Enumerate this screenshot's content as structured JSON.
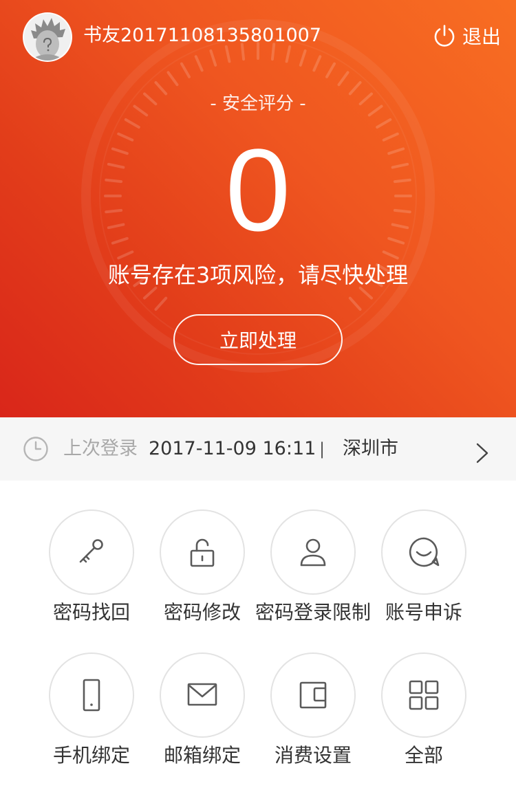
{
  "header": {
    "username": "书友20171108135801007",
    "logout_label": "退出"
  },
  "security": {
    "score_title": "- 安全评分 -",
    "score": "0",
    "risk_message": "账号存在3项风险，请尽快处理",
    "action_label": "立即处理"
  },
  "last_login": {
    "label": "上次登录",
    "time": "2017-11-09 16:11",
    "separator": "|",
    "city": "深圳市"
  },
  "actions": [
    {
      "label": "密码找回",
      "icon": "key-icon"
    },
    {
      "label": "密码修改",
      "icon": "unlock-icon"
    },
    {
      "label": "密码登录限制",
      "icon": "user-icon"
    },
    {
      "label": "账号申诉",
      "icon": "chat-icon"
    },
    {
      "label": "手机绑定",
      "icon": "phone-icon"
    },
    {
      "label": "邮箱绑定",
      "icon": "mail-icon"
    },
    {
      "label": "消费设置",
      "icon": "wallet-icon"
    },
    {
      "label": "全部",
      "icon": "grid-icon"
    }
  ],
  "colors": {
    "hero_start": "#f86e22",
    "hero_end": "#d9261a",
    "icon": "#5a5a5a",
    "circle_border": "#e3e3e3"
  }
}
